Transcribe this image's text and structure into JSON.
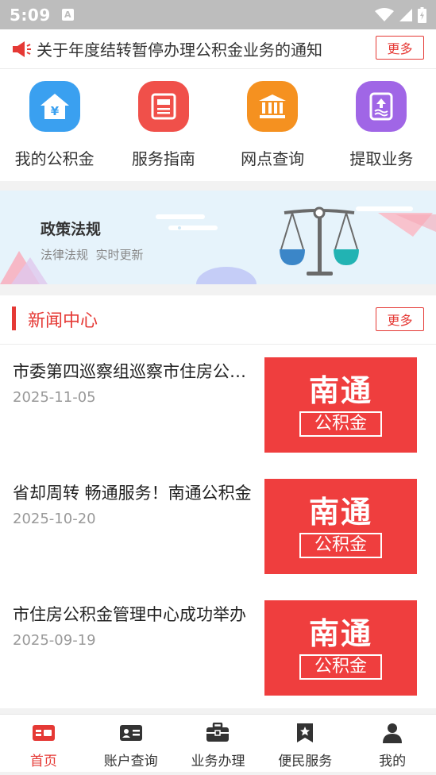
{
  "status_bar": {
    "time": "5:09",
    "notification_icon": "A"
  },
  "notice": {
    "text": "关于年度结转暂停办理公积金业务的通知",
    "more_label": "更多"
  },
  "quick_actions": [
    {
      "label": "我的公积金",
      "icon": "yuan-house-icon",
      "color": "#3aa0f0"
    },
    {
      "label": "服务指南",
      "icon": "document-icon",
      "color": "#f0504a"
    },
    {
      "label": "网点查询",
      "icon": "bank-icon",
      "color": "#f59120"
    },
    {
      "label": "提取业务",
      "icon": "withdraw-icon",
      "color": "#a066e6"
    }
  ],
  "banner": {
    "title": "政策法规",
    "subtitle": "法律法规  实时更新"
  },
  "news": {
    "title": "新闻中心",
    "more_label": "更多",
    "items": [
      {
        "title": "市委第四巡察组巡察市住房公积金管理中心",
        "date": "2025-11-05",
        "thumb_big": "南通",
        "thumb_small": "公积金"
      },
      {
        "title": "省却周转 畅通服务！南通公积金",
        "date": "2025-10-20",
        "thumb_big": "南通",
        "thumb_small": "公积金"
      },
      {
        "title": "市住房公积金管理中心成功举办",
        "date": "2025-09-19",
        "thumb_big": "南通",
        "thumb_small": "公积金"
      }
    ]
  },
  "tabs": [
    {
      "label": "首页",
      "icon": "home-card-icon",
      "active": true
    },
    {
      "label": "账户查询",
      "icon": "id-card-icon",
      "active": false
    },
    {
      "label": "业务办理",
      "icon": "briefcase-icon",
      "active": false
    },
    {
      "label": "便民服务",
      "icon": "bookmark-star-icon",
      "active": false
    },
    {
      "label": "我的",
      "icon": "user-icon",
      "active": false
    }
  ],
  "colors": {
    "accent": "#e53935",
    "thumb": "#ef3e3e"
  }
}
